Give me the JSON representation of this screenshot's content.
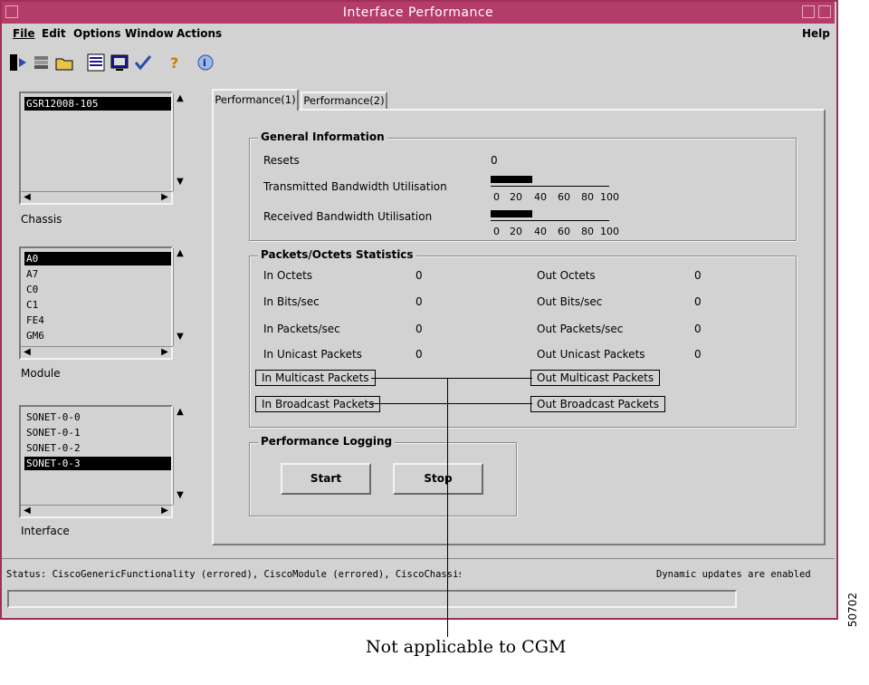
{
  "window": {
    "title": "Interface Performance"
  },
  "menu": {
    "file": "File",
    "edit": "Edit",
    "options": "Options",
    "window": "Window",
    "actions": "Actions",
    "help": "Help"
  },
  "toolbar": {
    "icons": [
      "exit-icon",
      "stack-icon",
      "folder-icon",
      "list-icon",
      "monitor-icon",
      "check-icon",
      "question-icon",
      "info-icon"
    ]
  },
  "chassis": {
    "label": "Chassis",
    "items": [
      "GSR12008-105"
    ],
    "selected": "GSR12008-105"
  },
  "module": {
    "label": "Module",
    "items": [
      "A0",
      "A7",
      "C0",
      "C1",
      "FE4",
      "GM6"
    ],
    "selected": "A0"
  },
  "interface": {
    "label": "Interface",
    "items": [
      "SONET-0-0",
      "SONET-0-1",
      "SONET-0-2",
      "SONET-0-3"
    ],
    "selected": "SONET-0-3"
  },
  "tabs": [
    "Performance(1)",
    "Performance(2)"
  ],
  "general": {
    "title": "General Information",
    "resets_label": "Resets",
    "resets_value": "0",
    "tx_label": "Transmitted Bandwidth Utilisation",
    "rx_label": "Received Bandwidth Utilisation",
    "tx_percent": 35,
    "rx_percent": 35,
    "scale": [
      "0",
      "20",
      "40",
      "60",
      "80",
      "100"
    ]
  },
  "packets": {
    "title": "Packets/Octets Statistics",
    "in_octets": "In Octets",
    "in_octets_v": "0",
    "out_octets": "Out Octets",
    "out_octets_v": "0",
    "in_bits": "In Bits/sec",
    "in_bits_v": "0",
    "out_bits": "Out Bits/sec",
    "out_bits_v": "0",
    "in_pps": "In Packets/sec",
    "in_pps_v": "0",
    "out_pps": "Out Packets/sec",
    "out_pps_v": "0",
    "in_ucast": "In Unicast Packets",
    "in_ucast_v": "0",
    "out_ucast": "Out Unicast Packets",
    "out_ucast_v": "0",
    "in_mcast": "In Multicast Packets",
    "out_mcast": "Out Multicast Packets",
    "in_bcast": "In Broadcast Packets",
    "out_bcast": "Out Broadcast Packets"
  },
  "logging": {
    "title": "Performance Logging",
    "start": "Start",
    "stop": "Stop"
  },
  "status": {
    "text": "Status: CiscoGenericFunctionality (errored), CiscoModule (errored), CiscoChassis (n",
    "updates": "Dynamic updates are enabled"
  },
  "annotation": {
    "callout": "Not applicable to CGM",
    "figure_id": "50702"
  }
}
